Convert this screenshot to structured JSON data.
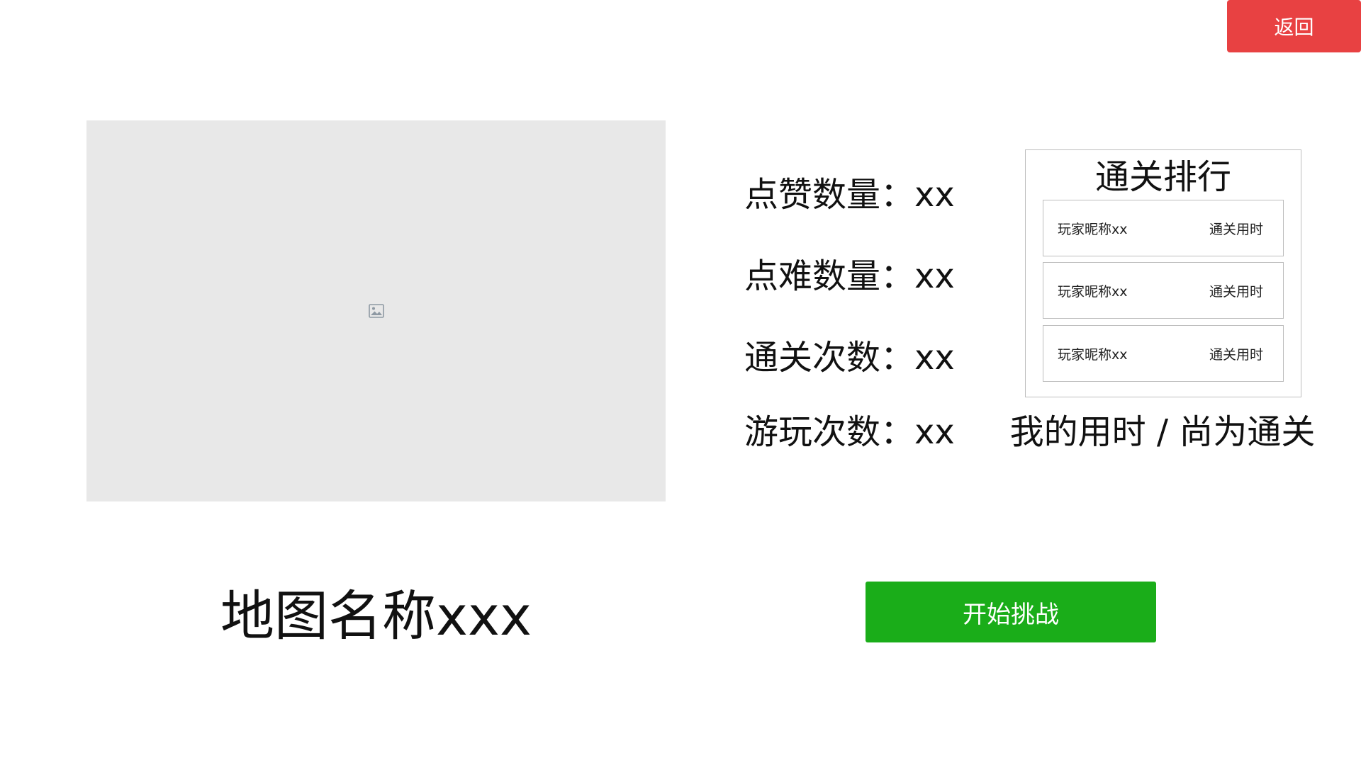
{
  "colors": {
    "back_button_bg": "#e84142",
    "start_button_bg": "#1aad19",
    "image_placeholder_bg": "#e8e8e8",
    "image_icon": "#8e99a3"
  },
  "header": {
    "back_label": "返回"
  },
  "map": {
    "image_icon": "image-icon",
    "name": "地图名称xxx"
  },
  "stats": [
    {
      "label": "点赞数量：",
      "value": "xx"
    },
    {
      "label": "点难数量：",
      "value": "xx"
    },
    {
      "label": "通关次数：",
      "value": "xx"
    },
    {
      "label": "游玩次数：",
      "value": "xx"
    }
  ],
  "ranking": {
    "title": "通关排行",
    "rows": [
      {
        "player": "玩家昵称xx",
        "time": "通关用时"
      },
      {
        "player": "玩家昵称xx",
        "time": "通关用时"
      },
      {
        "player": "玩家昵称xx",
        "time": "通关用时"
      }
    ]
  },
  "my_time": "我的用时 / 尚为通关",
  "actions": {
    "start_label": "开始挑战"
  }
}
